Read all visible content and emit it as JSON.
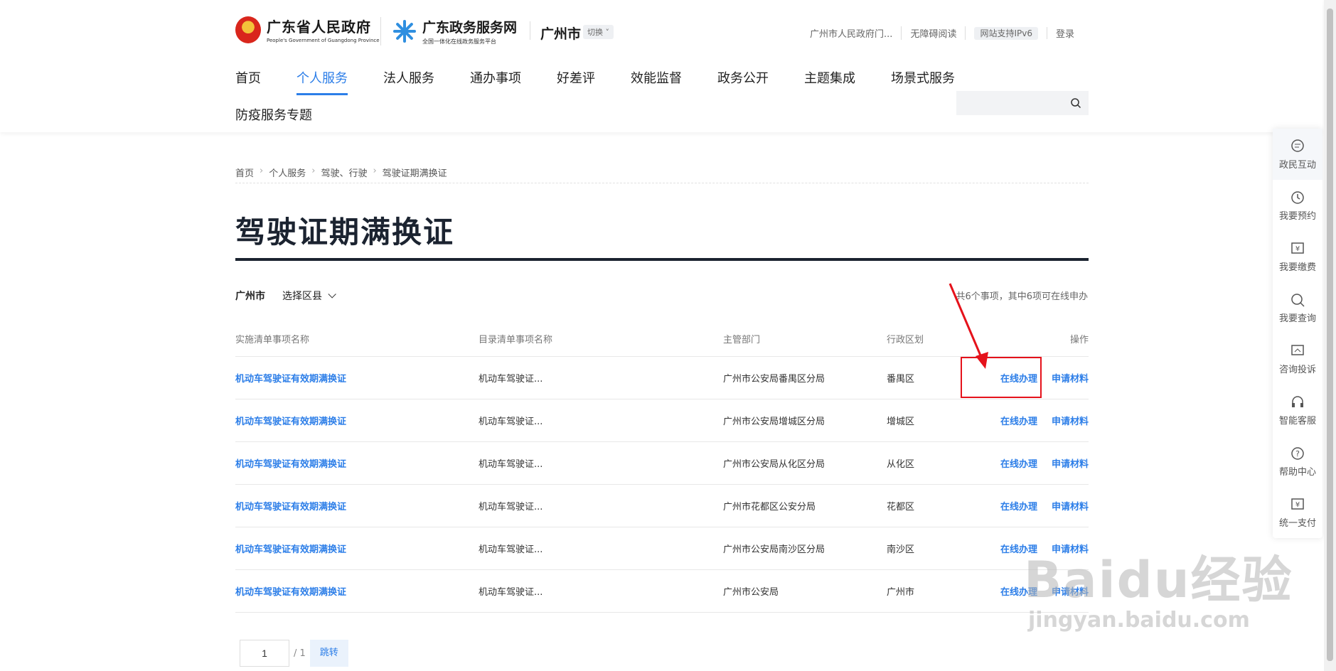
{
  "header": {
    "gov_name": "广东省人民政府",
    "gov_name_en": "People's Government of Guangdong Province",
    "portal_name": "广东政务服务网",
    "portal_sub": "全国一体化在线政务服务平台",
    "city": "广州市",
    "switch_label": "切换",
    "top_links": [
      "广州市人民政府门...",
      "无障碍阅读",
      "网站支持IPv6",
      "登录"
    ],
    "nav": [
      "首页",
      "个人服务",
      "法人服务",
      "通办事项",
      "好差评",
      "效能监督",
      "政务公开",
      "主题集成",
      "场景式服务"
    ],
    "nav_active_index": 1,
    "nav_row2": "防疫服务专题",
    "search_placeholder": ""
  },
  "breadcrumb": [
    "首页",
    "个人服务",
    "驾驶、行驶",
    "驾驶证期满换证"
  ],
  "page_title": "驾驶证期满换证",
  "filter": {
    "city": "广州市",
    "district_label": "选择区县",
    "summary": "共6个事项，其中6项可在线申办"
  },
  "table": {
    "headers": [
      "实施清单事项名称",
      "目录清单事项名称",
      "主管部门",
      "行政区划",
      "操作"
    ],
    "rows": [
      {
        "name": "机动车驾驶证有效期满换证",
        "catalog": "机动车驾驶证...",
        "dept": "广州市公安局番禺区分局",
        "region": "番禺区",
        "op1": "在线办理",
        "op2": "申请材料"
      },
      {
        "name": "机动车驾驶证有效期满换证",
        "catalog": "机动车驾驶证...",
        "dept": "广州市公安局增城区分局",
        "region": "增城区",
        "op1": "在线办理",
        "op2": "申请材料"
      },
      {
        "name": "机动车驾驶证有效期满换证",
        "catalog": "机动车驾驶证...",
        "dept": "广州市公安局从化区分局",
        "region": "从化区",
        "op1": "在线办理",
        "op2": "申请材料"
      },
      {
        "name": "机动车驾驶证有效期满换证",
        "catalog": "机动车驾驶证...",
        "dept": "广州市花都区公安分局",
        "region": "花都区",
        "op1": "在线办理",
        "op2": "申请材料"
      },
      {
        "name": "机动车驾驶证有效期满换证",
        "catalog": "机动车驾驶证...",
        "dept": "广州市公安局南沙区分局",
        "region": "南沙区",
        "op1": "在线办理",
        "op2": "申请材料"
      },
      {
        "name": "机动车驾驶证有效期满换证",
        "catalog": "机动车驾驶证...",
        "dept": "广州市公安局",
        "region": "广州市",
        "op1": "在线办理",
        "op2": "申请材料"
      }
    ]
  },
  "pager": {
    "current": "1",
    "total": "/ 1",
    "jump_label": "跳转"
  },
  "float_bar": [
    {
      "label": "政民互动",
      "icon": "chat-icon"
    },
    {
      "label": "我要预约",
      "icon": "clock-icon"
    },
    {
      "label": "我要缴费",
      "icon": "payment-icon"
    },
    {
      "label": "我要查询",
      "icon": "search-icon"
    },
    {
      "label": "咨询投诉",
      "icon": "complaint-icon"
    },
    {
      "label": "智能客服",
      "icon": "headset-icon"
    },
    {
      "label": "帮助中心",
      "icon": "help-icon"
    },
    {
      "label": "统一支付",
      "icon": "payment-icon"
    }
  ],
  "watermark": {
    "brand": "Baidu经验",
    "url": "jingyan.baidu.com"
  },
  "colors": {
    "accent": "#2c7ee8",
    "highlight": "#e5121b",
    "title": "#1b2330"
  }
}
